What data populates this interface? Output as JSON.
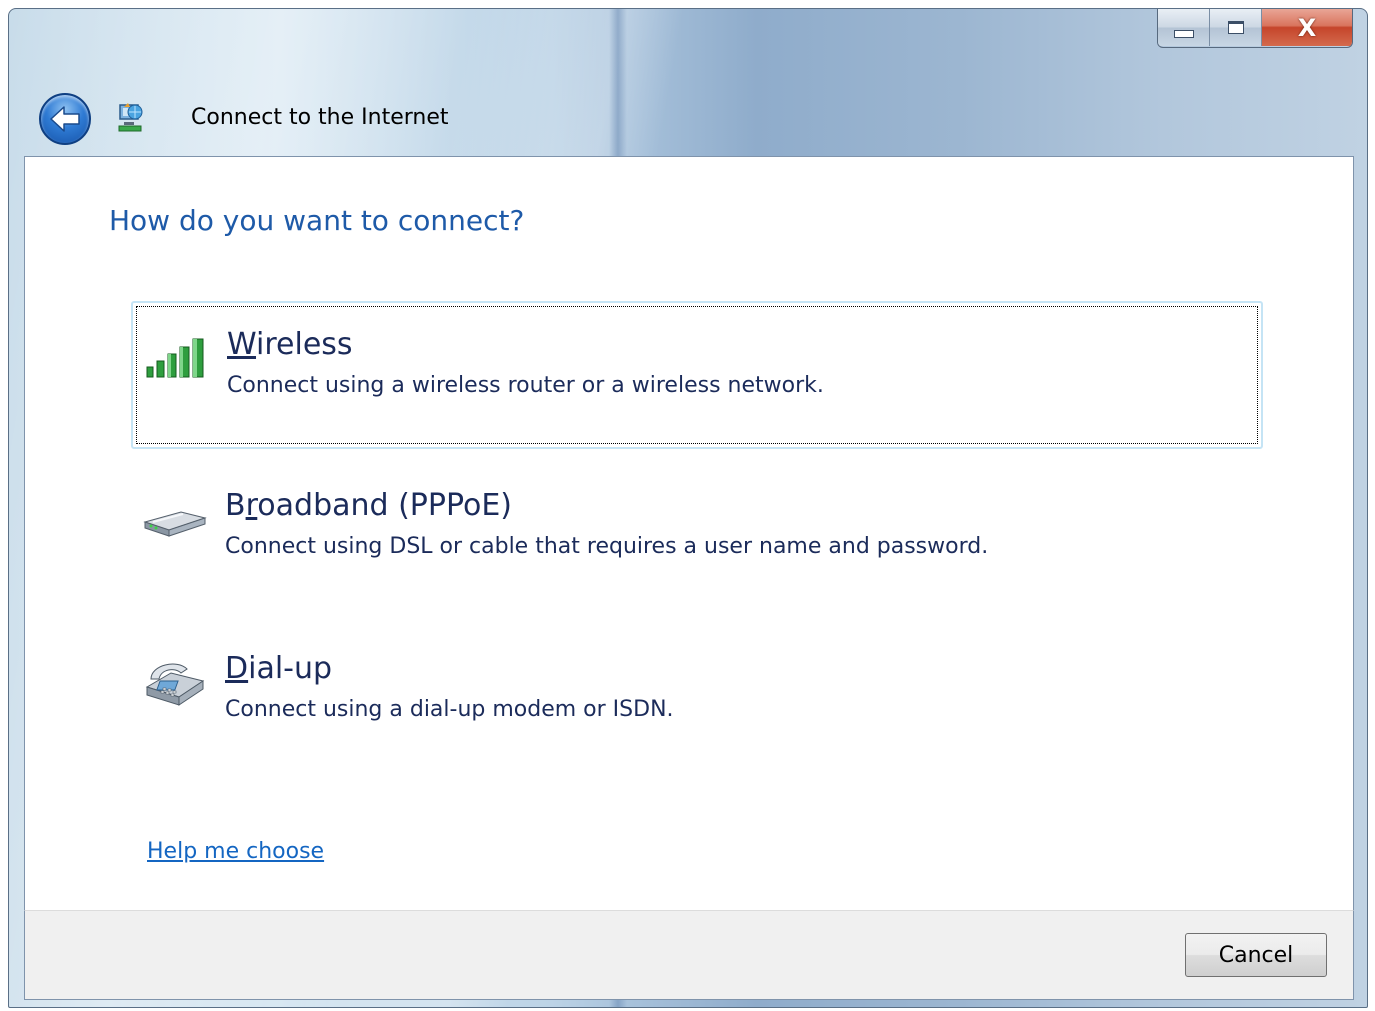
{
  "window": {
    "title": "Connect to the Internet",
    "caption": {
      "minimize_icon": "minimize-icon",
      "maximize_icon": "maximize-icon",
      "close_glyph": "X"
    }
  },
  "main": {
    "heading": "How do you want to connect?",
    "options": [
      {
        "icon": "wireless-signal-icon",
        "title_accesskey": "W",
        "title_rest": "ireless",
        "description": "Connect using a wireless router or a wireless network.",
        "focused": true
      },
      {
        "icon": "broadband-modem-icon",
        "title_prefix": "B",
        "title_accesskey": "r",
        "title_rest": "oadband (PPPoE)",
        "description": "Connect using DSL or cable that requires a user name and password.",
        "focused": false
      },
      {
        "icon": "dialup-phone-icon",
        "title_accesskey": "D",
        "title_rest": "ial-up",
        "description": "Connect using a dial-up modem or ISDN.",
        "focused": false
      }
    ],
    "help_link": "Help me choose"
  },
  "footer": {
    "cancel_label": "Cancel"
  },
  "colors": {
    "heading": "#1e5aa8",
    "link": "#1466c2",
    "footer_bg": "#f0f0f0"
  }
}
